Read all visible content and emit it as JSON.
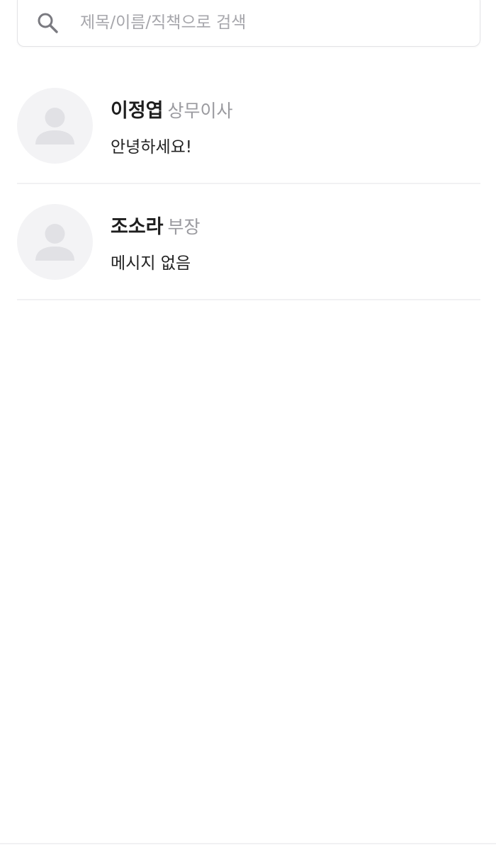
{
  "search": {
    "placeholder": "제목/이름/직책으로 검색",
    "value": ""
  },
  "contacts": [
    {
      "name": "이정엽",
      "title": "상무이사",
      "message": "안녕하세요!"
    },
    {
      "name": "조소라",
      "title": "부장",
      "message": "메시지 없음"
    }
  ],
  "colors": {
    "placeholder": "#a6a6ab",
    "title_gray": "#9a9a9f",
    "avatar_bg": "#f3f3f5",
    "avatar_fg": "#e1e1e5",
    "divider": "#f1f1f3"
  }
}
